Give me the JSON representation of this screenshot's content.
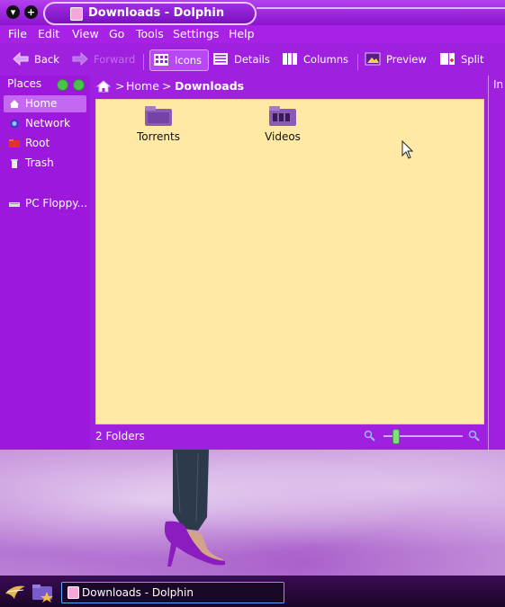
{
  "window": {
    "title": "Downloads - Dolphin",
    "accent": "#a020e0"
  },
  "menu": [
    "File",
    "Edit",
    "View",
    "Go",
    "Tools",
    "Settings",
    "Help"
  ],
  "toolbar": {
    "back": "Back",
    "forward": "Forward",
    "icons": "Icons",
    "details": "Details",
    "columns": "Columns",
    "preview": "Preview",
    "split": "Split"
  },
  "places": {
    "header": "Places",
    "items": [
      {
        "label": "Home",
        "icon": "home-icon"
      },
      {
        "label": "Network",
        "icon": "network-icon"
      },
      {
        "label": "Root",
        "icon": "root-folder-icon"
      },
      {
        "label": "Trash",
        "icon": "trash-icon"
      },
      {
        "label": "PC Floppy...",
        "icon": "floppy-icon"
      }
    ]
  },
  "breadcrumb": {
    "home": "Home",
    "current": "Downloads",
    "separator": ">"
  },
  "info_panel": {
    "label": "In"
  },
  "items": [
    {
      "label": "Torrents",
      "icon": "folder-icon"
    },
    {
      "label": "Videos",
      "icon": "video-folder-icon"
    }
  ],
  "status": {
    "text": "2 Folders",
    "zoom_fraction": 0.12
  },
  "taskbar": {
    "task_label": "Downloads - Dolphin"
  },
  "colors": {
    "content_bg": "#ffe9a4",
    "panel": "#9c18dc",
    "taskbar": "#1a0628"
  }
}
